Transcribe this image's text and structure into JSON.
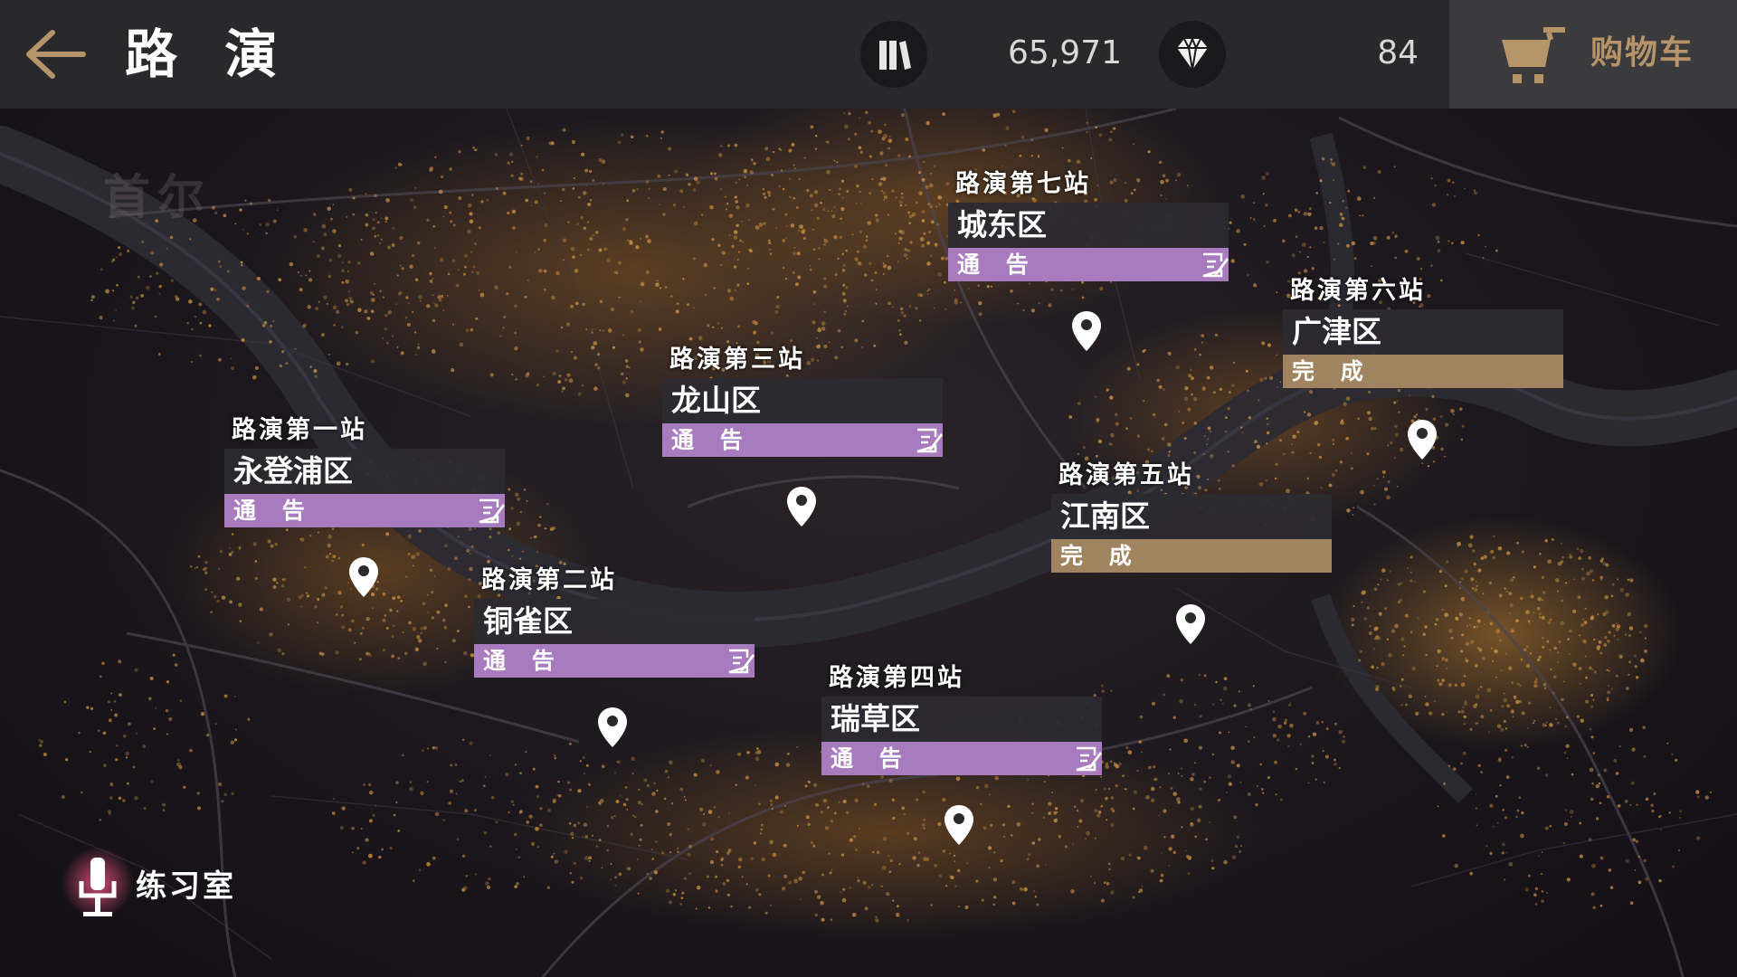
{
  "header": {
    "title": "路 演",
    "coins": "65,971",
    "gems": "84",
    "cart_label": "购物车"
  },
  "map": {
    "city_name": "首尔"
  },
  "stops": [
    {
      "title": "路演第一站",
      "district": "永登浦区",
      "status": "通 告",
      "state": "notice"
    },
    {
      "title": "路演第二站",
      "district": "铜雀区",
      "status": "通 告",
      "state": "notice"
    },
    {
      "title": "路演第三站",
      "district": "龙山区",
      "status": "通 告",
      "state": "notice"
    },
    {
      "title": "路演第四站",
      "district": "瑞草区",
      "status": "通 告",
      "state": "notice"
    },
    {
      "title": "路演第五站",
      "district": "江南区",
      "status": "完 成",
      "state": "done"
    },
    {
      "title": "路演第六站",
      "district": "广津区",
      "status": "完 成",
      "state": "done"
    },
    {
      "title": "路演第七站",
      "district": "城东区",
      "status": "通 告",
      "state": "notice"
    }
  ],
  "practice": {
    "label": "练习室"
  },
  "colors": {
    "notice": "#a77bbd",
    "done": "#a08460",
    "accent": "#b6946a",
    "back_arrow": "#b6946a"
  }
}
